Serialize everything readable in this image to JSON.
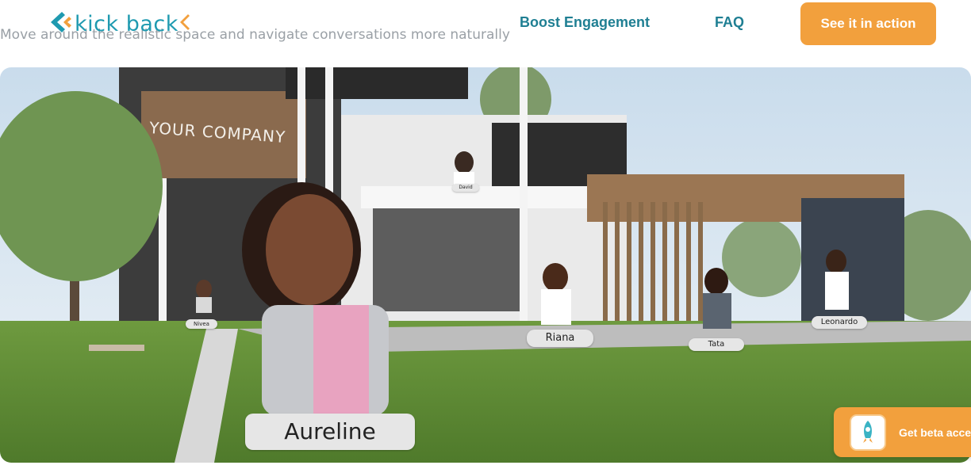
{
  "page": {
    "subtitle": "Move around the realistic space and navigate conversations more naturally"
  },
  "header": {
    "logo_text": "kick back",
    "nav": [
      {
        "label": "Boost Engagement"
      },
      {
        "label": "FAQ"
      }
    ],
    "cta_label": "See it in action"
  },
  "hero": {
    "sign_text": "YOUR COMPANY",
    "avatars": [
      {
        "name": "Aureline"
      },
      {
        "name": "Riana"
      },
      {
        "name": "Tata"
      },
      {
        "name": "Leonardo"
      },
      {
        "name": "Nivea"
      },
      {
        "name": "David"
      }
    ]
  },
  "beta": {
    "label": "Get beta access",
    "icon": "rocket-icon"
  },
  "colors": {
    "brand_teal": "#1f9ab0",
    "accent_orange": "#f2a03d",
    "nav_text": "#1f7f93"
  }
}
